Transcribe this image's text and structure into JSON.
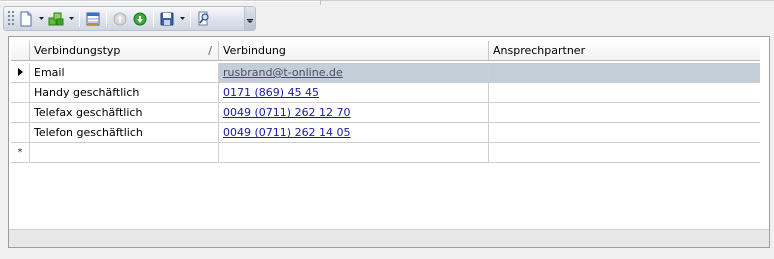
{
  "toolbar": {
    "buttons": [
      {
        "name": "new-record",
        "icon": "new-document-icon",
        "dropdown": true,
        "enabled": true
      },
      {
        "name": "add-entries",
        "icon": "green-blocks-icon",
        "dropdown": true,
        "enabled": true
      },
      {
        "name": "data-view",
        "icon": "table-icon",
        "dropdown": false,
        "enabled": true
      },
      {
        "name": "move-up",
        "icon": "up-arrow-circle-icon",
        "dropdown": false,
        "enabled": false
      },
      {
        "name": "move-down",
        "icon": "down-arrow-circle-icon",
        "dropdown": false,
        "enabled": true
      },
      {
        "name": "save",
        "icon": "floppy-disk-icon",
        "dropdown": true,
        "enabled": true
      },
      {
        "name": "search",
        "icon": "magnifier-document-icon",
        "dropdown": false,
        "enabled": true
      }
    ]
  },
  "grid": {
    "columns": [
      {
        "label": "Verbindungstyp",
        "sort_indicator": "/"
      },
      {
        "label": "Verbindung",
        "sort_indicator": ""
      },
      {
        "label": "Ansprechpartner",
        "sort_indicator": ""
      }
    ],
    "rows": [
      {
        "typ": "Email",
        "verbindung": "rusbrand@t-online.de",
        "ansprechpartner": "",
        "selected": true
      },
      {
        "typ": "Handy geschäftlich",
        "verbindung": "0171 (869) 45 45",
        "ansprechpartner": "",
        "selected": false
      },
      {
        "typ": "Telefax geschäftlich",
        "verbindung": "0049 (0711) 262 12 70",
        "ansprechpartner": "",
        "selected": false
      },
      {
        "typ": "Telefon geschäftlich",
        "verbindung": "0049 (0711) 262 14 05",
        "ansprechpartner": "",
        "selected": false
      }
    ],
    "new_row_marker": "*",
    "current_row_marker": "▶"
  },
  "colors": {
    "selection": "#c4ced9",
    "link": "#1a1aa6",
    "grid_border": "#9d9d9d"
  }
}
